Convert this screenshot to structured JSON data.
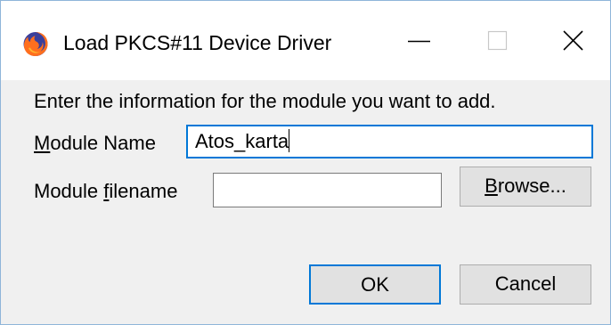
{
  "window": {
    "title": "Load PKCS#11 Device Driver",
    "icon": "firefox-icon",
    "controls": {
      "minimize": "minimize-icon",
      "maximize": "maximize-icon",
      "close": "close-icon"
    }
  },
  "dialog": {
    "intro": "Enter the information for the module you want to add.",
    "module_name": {
      "label_mnemonic": "M",
      "label_rest": "odule Name",
      "value": "Atos_karta"
    },
    "module_filename": {
      "label_before": "Module ",
      "label_mnemonic": "f",
      "label_after": "ilename",
      "value": ""
    },
    "browse_button": {
      "mnemonic": "B",
      "rest": "rowse..."
    },
    "ok_button": "OK",
    "cancel_button": "Cancel"
  },
  "colors": {
    "accent": "#0078d7",
    "dialog_background": "#f0f0f0",
    "button_face": "#e1e1e1",
    "window_border": "#8fb5d9"
  }
}
